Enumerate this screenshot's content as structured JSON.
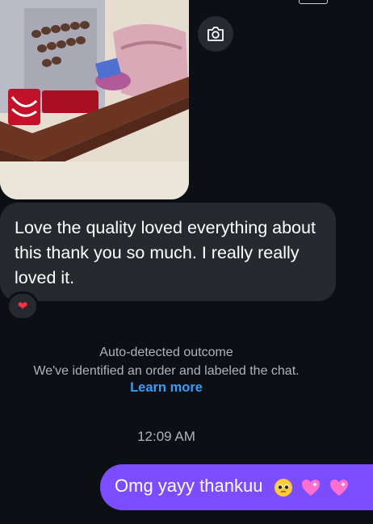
{
  "thread": {
    "photo_icon": "camera-icon",
    "incoming_message": "Love the quality loved everything about this thank you so much. I really really loved it.",
    "reaction": "❤",
    "outcome": {
      "title": "Auto-detected outcome",
      "description": "We've identified an order and labeled the chat.",
      "link": "Learn more"
    },
    "timestamp": "12:09 AM",
    "outgoing_message": {
      "text": "Omg yayy thankuu",
      "emojis": [
        "pleading-face-emoji",
        "sparkling-heart-emoji",
        "sparkling-heart-emoji"
      ]
    }
  },
  "colors": {
    "background": "#0c0f14",
    "incoming_bubble": "#262a2f",
    "outgoing_bubble": "#7c4dff",
    "link": "#3b9bf5",
    "muted_text": "#b0b4ba"
  }
}
